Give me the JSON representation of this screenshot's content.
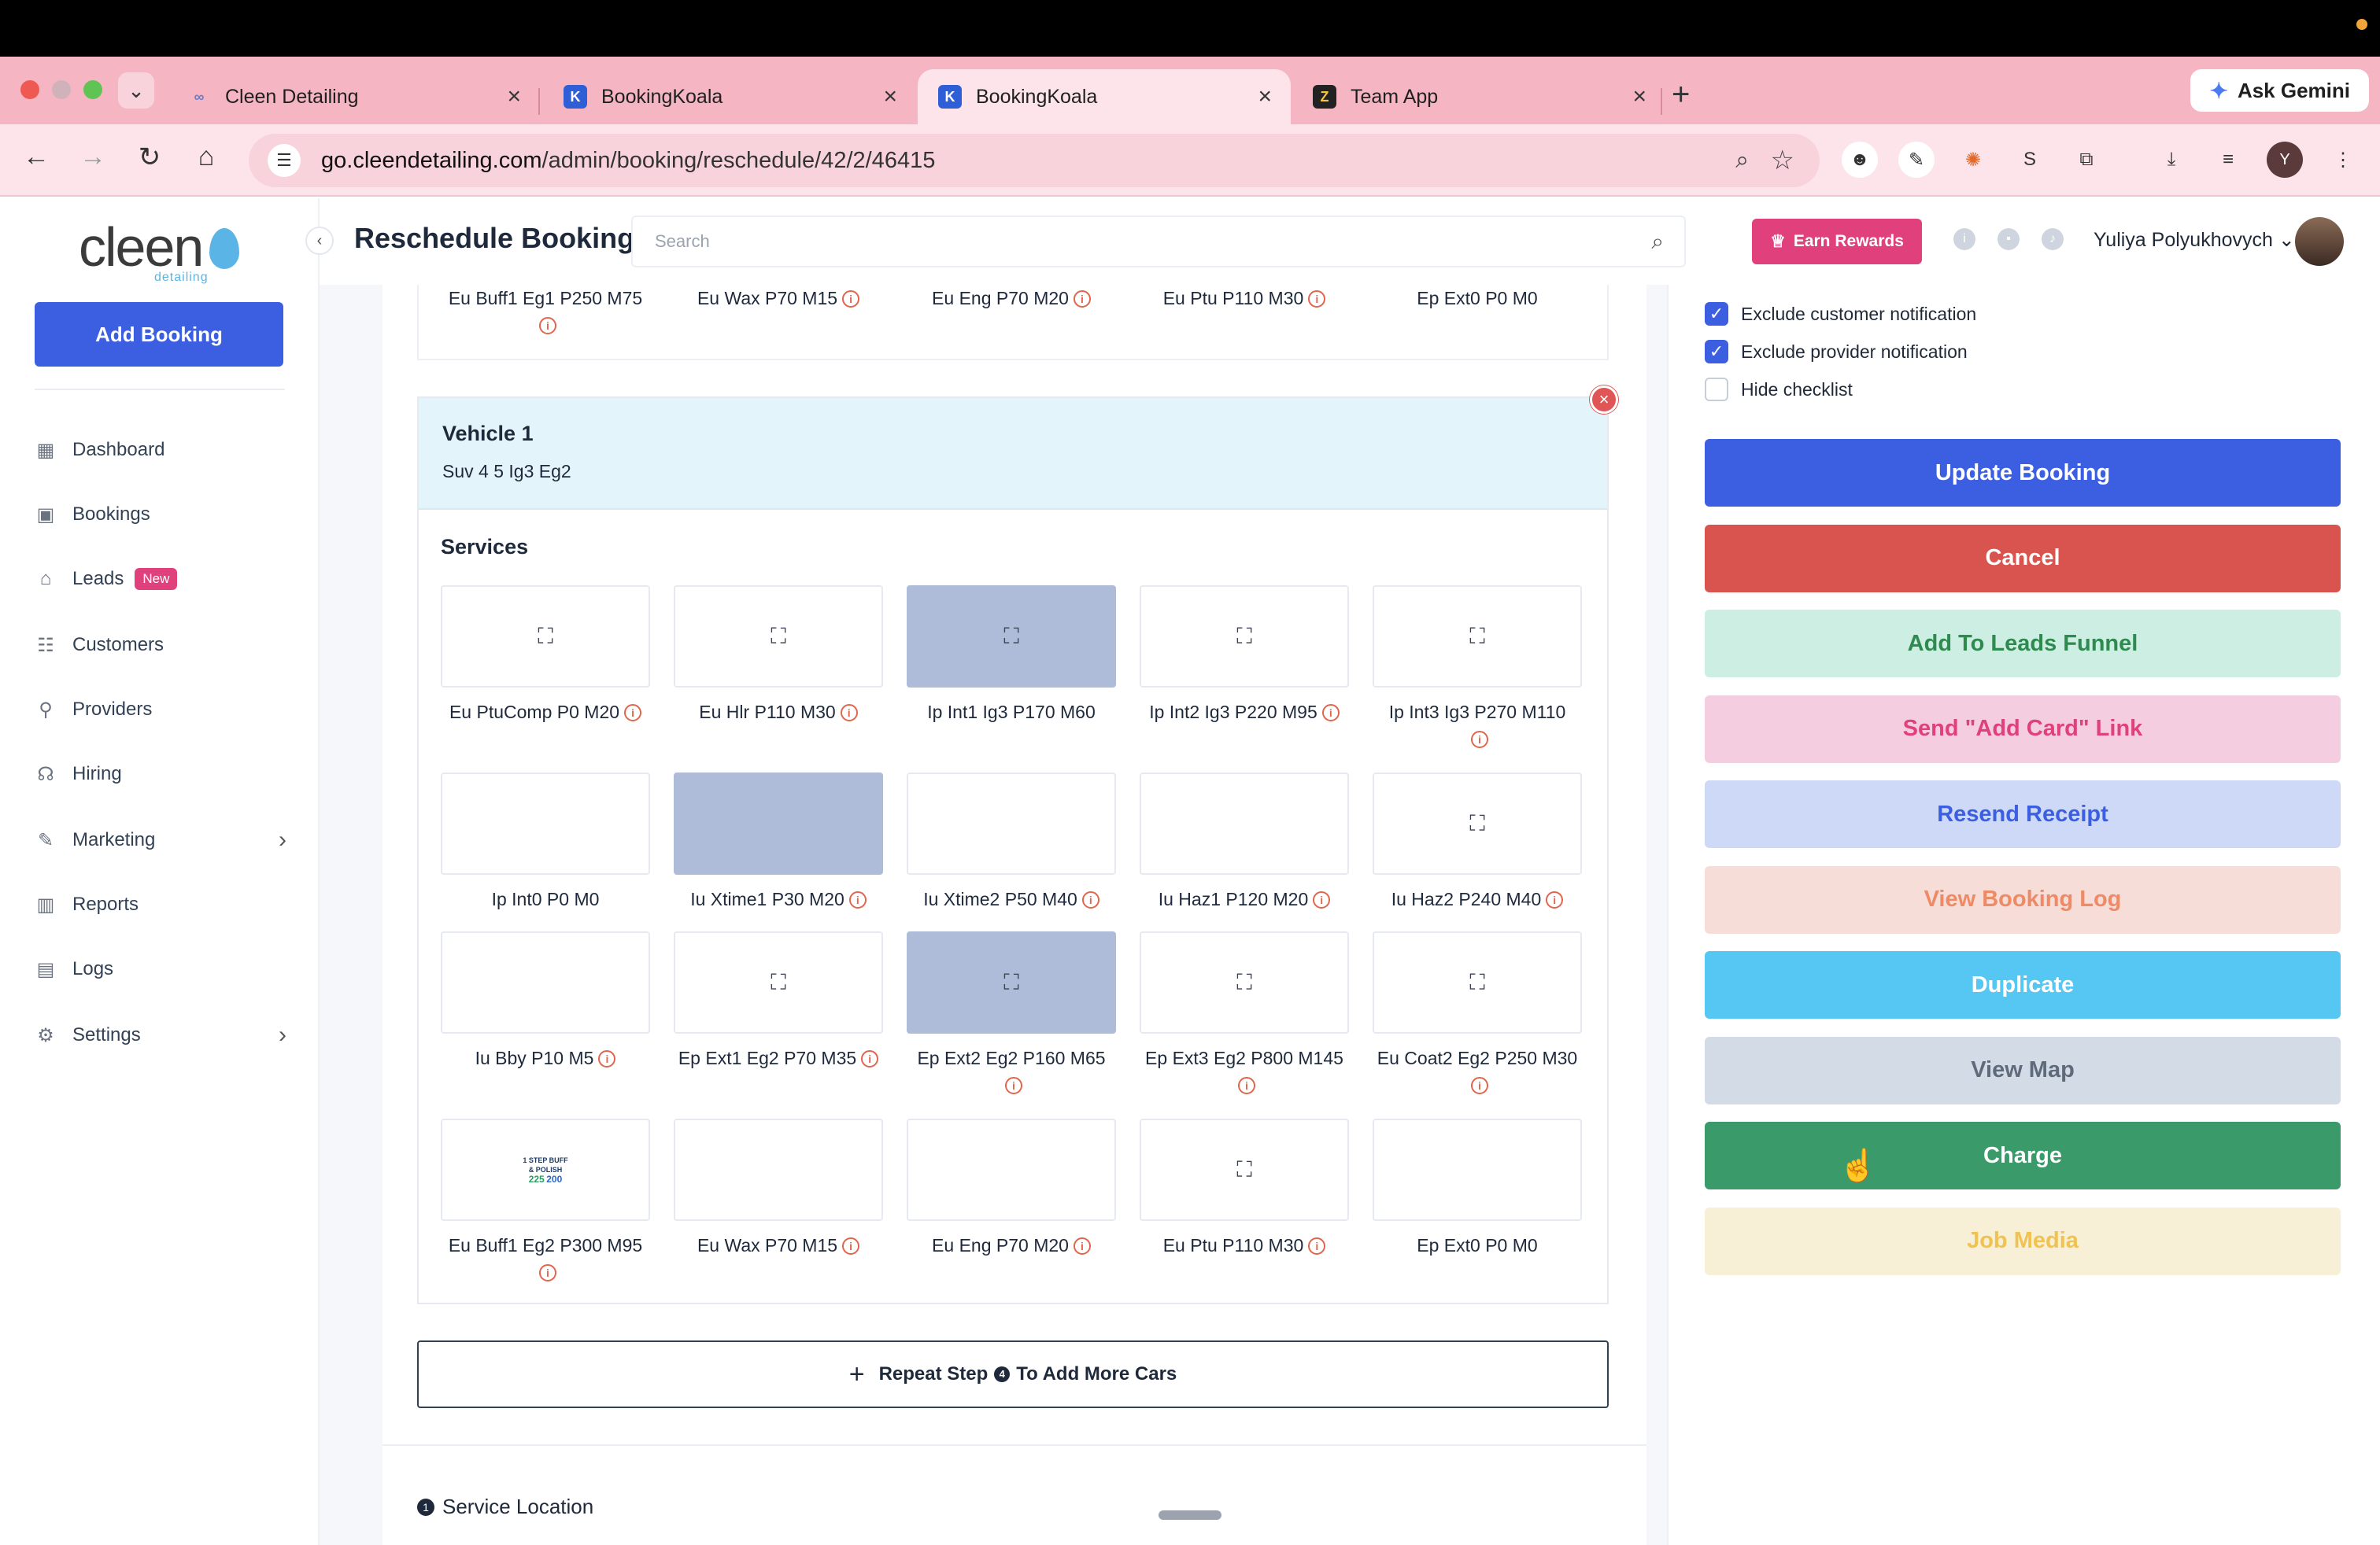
{
  "browser": {
    "tabs": [
      {
        "title": "Cleen Detailing",
        "fav_color": "#f5b5c3"
      },
      {
        "title": "BookingKoala",
        "fav_color": "#2f5fd6"
      },
      {
        "title": "BookingKoala",
        "fav_color": "#2f5fd6"
      },
      {
        "title": "Team App",
        "fav_color": "#222222"
      }
    ],
    "gemini_label": "Ask Gemini",
    "url_host": "go.cleendetailing.com",
    "url_path": "/admin/booking/reschedule/42/2/46415",
    "profile_initial": "Y"
  },
  "sidebar": {
    "logo": "cleen",
    "logo_sub": "detailing",
    "add_booking": "Add Booking",
    "items": [
      {
        "label": "Dashboard",
        "icon": "dashboard-icon",
        "glyph": "▦"
      },
      {
        "label": "Bookings",
        "icon": "bookings-icon",
        "glyph": "▣"
      },
      {
        "label": "Leads",
        "icon": "leads-icon",
        "glyph": "⌂",
        "badge": "New"
      },
      {
        "label": "Customers",
        "icon": "customers-icon",
        "glyph": "☷"
      },
      {
        "label": "Providers",
        "icon": "providers-icon",
        "glyph": "⚲"
      },
      {
        "label": "Hiring",
        "icon": "hiring-icon",
        "glyph": "☊"
      },
      {
        "label": "Marketing",
        "icon": "marketing-icon",
        "glyph": "✎",
        "has_children": true
      },
      {
        "label": "Reports",
        "icon": "reports-icon",
        "glyph": "▥"
      },
      {
        "label": "Logs",
        "icon": "logs-icon",
        "glyph": "▤"
      },
      {
        "label": "Settings",
        "icon": "settings-icon",
        "glyph": "⚙",
        "has_children": true
      }
    ]
  },
  "header": {
    "title": "Reschedule Booking",
    "search_placeholder": "Search",
    "earn_rewards": "Earn Rewards",
    "user_name": "Yuliya Polyukhovych"
  },
  "previous_row": [
    {
      "label": "Eu Buff1 Eg1 P250 M75",
      "info": true
    },
    {
      "label": "Eu Wax P70 M15",
      "info": true
    },
    {
      "label": "Eu Eng P70 M20",
      "info": true
    },
    {
      "label": "Eu Ptu P110 M30",
      "info": true
    },
    {
      "label": "Ep Ext0 P0 M0",
      "info": false
    }
  ],
  "vehicle": {
    "title": "Vehicle 1",
    "subtitle": "Suv 4 5 Ig3 Eg2",
    "services_title": "Services",
    "services": [
      {
        "label": "Eu PtuComp P0 M20",
        "info": true,
        "icon": true,
        "selected": false
      },
      {
        "label": "Eu Hlr P110 M30",
        "info": true,
        "icon": true,
        "selected": false
      },
      {
        "label": "Ip Int1 Ig3 P170 M60",
        "info": false,
        "icon": true,
        "selected": true
      },
      {
        "label": "Ip Int2 Ig3 P220 M95",
        "info": true,
        "icon": true,
        "selected": false
      },
      {
        "label": "Ip Int3 Ig3 P270 M110",
        "info": true,
        "icon": true,
        "selected": false
      },
      {
        "label": "Ip Int0 P0 M0",
        "info": false,
        "icon": false,
        "selected": false
      },
      {
        "label": "Iu Xtime1 P30 M20",
        "info": true,
        "icon": false,
        "selected": true
      },
      {
        "label": "Iu Xtime2 P50 M40",
        "info": true,
        "icon": false,
        "selected": false
      },
      {
        "label": "Iu Haz1 P120 M20",
        "info": true,
        "icon": false,
        "selected": false
      },
      {
        "label": "Iu Haz2 P240 M40",
        "info": true,
        "icon": true,
        "selected": false
      },
      {
        "label": "Iu Bby P10 M5",
        "info": true,
        "icon": false,
        "selected": false
      },
      {
        "label": "Ep Ext1 Eg2 P70 M35",
        "info": true,
        "icon": true,
        "selected": false
      },
      {
        "label": "Ep Ext2 Eg2 P160 M65",
        "info": true,
        "icon": true,
        "selected": true
      },
      {
        "label": "Ep Ext3 Eg2 P800 M145",
        "info": true,
        "icon": true,
        "selected": false
      },
      {
        "label": "Eu Coat2 Eg2 P250 M30",
        "info": true,
        "icon": true,
        "selected": false
      },
      {
        "label": "Eu Buff1 Eg2 P300 M95",
        "info": true,
        "icon": false,
        "buff_image": true,
        "selected": false
      },
      {
        "label": "Eu Wax P70 M15",
        "info": true,
        "icon": false,
        "selected": false
      },
      {
        "label": "Eu Eng P70 M20",
        "info": true,
        "icon": false,
        "selected": false
      },
      {
        "label": "Eu Ptu P110 M30",
        "info": true,
        "icon": true,
        "selected": false
      },
      {
        "label": "Ep Ext0 P0 M0",
        "info": false,
        "icon": false,
        "selected": false
      }
    ],
    "buff_image_text": {
      "line1": "1 STEP BUFF",
      "line2": "& POLISH",
      "n1": "225",
      "n2": "200"
    }
  },
  "repeat_step": {
    "before": "Repeat Step",
    "num": "4",
    "after": "To Add More Cars"
  },
  "service_location": {
    "num": "1",
    "label": "Service Location"
  },
  "right_panel": {
    "checkboxes": [
      {
        "label": "Exclude customer notification",
        "checked": true
      },
      {
        "label": "Exclude provider notification",
        "checked": true
      },
      {
        "label": "Hide checklist",
        "checked": false
      }
    ],
    "actions": [
      {
        "label": "Update Booking",
        "bg": "#3b5fe0",
        "fg": "#ffffff"
      },
      {
        "label": "Cancel",
        "bg": "#d9534f",
        "fg": "#ffffff"
      },
      {
        "label": "Add To Leads Funnel",
        "bg": "#cdeee2",
        "fg": "#2f8a4f"
      },
      {
        "label": "Send \"Add Card\" Link",
        "bg": "#f4cde0",
        "fg": "#e0407b"
      },
      {
        "label": "Resend Receipt",
        "bg": "#cdd9f6",
        "fg": "#3b5fe0"
      },
      {
        "label": "View Booking Log",
        "bg": "#f6ddd8",
        "fg": "#ee8a66"
      },
      {
        "label": "Duplicate",
        "bg": "#56c6f2",
        "fg": "#ffffff"
      },
      {
        "label": "View Map",
        "bg": "#d3dce6",
        "fg": "#5f6b7a"
      },
      {
        "label": "Charge",
        "bg": "#3a9a6a",
        "fg": "#ffffff"
      },
      {
        "label": "Job Media",
        "bg": "#f7efd6",
        "fg": "#f0c24f"
      }
    ]
  }
}
